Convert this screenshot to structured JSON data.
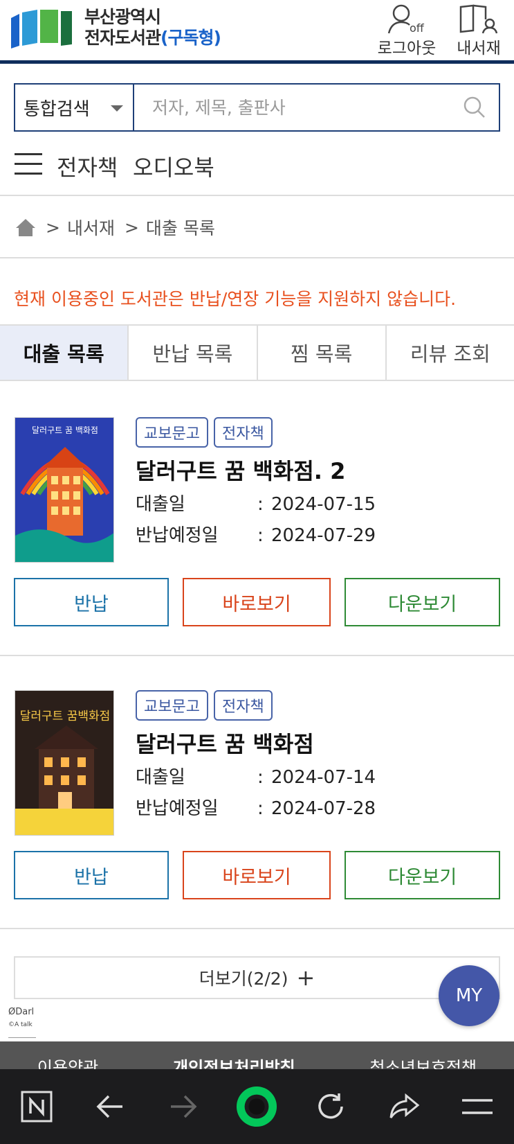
{
  "header": {
    "logo_line1": "부산광역시",
    "logo_line2": "전자도서관",
    "logo_line2_sub": "(구독형)",
    "logout_label": "로그아웃",
    "logout_badge": "off",
    "mybooks_label": "내서재"
  },
  "search": {
    "scope": "통합검색",
    "placeholder": "저자, 제목, 출판사"
  },
  "categories": [
    "전자책",
    "오디오북"
  ],
  "breadcrumb": [
    "내서재",
    "대출 목록"
  ],
  "notice": "현재 이용중인 도서관은 반납/연장 기능을 지원하지 않습니다.",
  "tabs": [
    "대출 목록",
    "반납 목록",
    "찜 목록",
    "리뷰 조회"
  ],
  "loans": [
    {
      "badges": [
        "교보문고",
        "전자책"
      ],
      "title": "달러구트 꿈 백화점. 2",
      "loan_label": "대출일",
      "loan_date": "2024-07-15",
      "due_label": "반납예정일",
      "due_date": "2024-07-29",
      "cover_text": "달러구트 꿈 백화점"
    },
    {
      "badges": [
        "교보문고",
        "전자책"
      ],
      "title": "달러구트 꿈 백화점",
      "loan_label": "대출일",
      "loan_date": "2024-07-14",
      "due_label": "반납예정일",
      "due_date": "2024-07-28",
      "cover_text": "달러구트 꿈백화점"
    }
  ],
  "buttons": {
    "return": "반납",
    "view": "바로보기",
    "download": "다운보기"
  },
  "more_label": "더보기(2/2)",
  "my_fab": "MY",
  "darl": {
    "line1": "ØDarl",
    "line2": "©A talk"
  },
  "footer": [
    "이용약관",
    "개인정보처리방침",
    "청소년보호정책"
  ]
}
